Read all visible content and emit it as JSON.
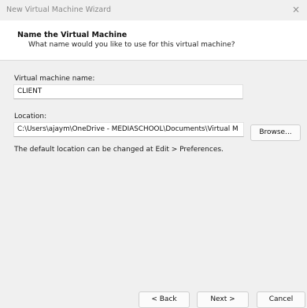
{
  "window": {
    "title": "New Virtual Machine Wizard",
    "close_symbol": "×"
  },
  "header": {
    "title": "Name the Virtual Machine",
    "subtitle": "What name would you like to use for this virtual machine?"
  },
  "form": {
    "vm_name_label": "Virtual machine name:",
    "vm_name_value": "CLIENT",
    "location_label": "Location:",
    "location_value": "C:\\Users\\ajaym\\OneDrive - MEDIASCHOOL\\Documents\\Virtual M",
    "browse_label": "Browse...",
    "info_text": "The default location can be changed at Edit > Preferences."
  },
  "footer": {
    "back_label": "< Back",
    "next_label": "Next >",
    "cancel_label": "Cancel"
  }
}
